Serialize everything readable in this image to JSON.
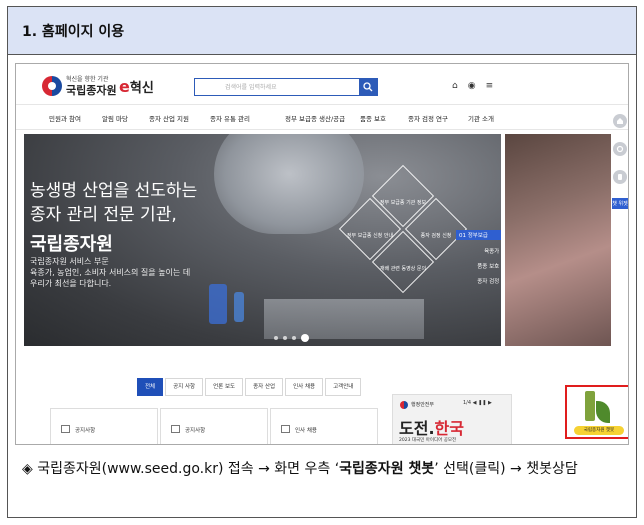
{
  "header": {
    "title": "1. 홈페이지 이용"
  },
  "site": {
    "logo_sub": "혁신을 향한 기관",
    "logo_name": "국립종자원",
    "logo_e": "e",
    "logo_hyeoksin": "혁신",
    "search_placeholder": "검색어를 입력하세요",
    "top_icons": [
      "home-icon",
      "globe-icon",
      "menu-icon"
    ]
  },
  "nav": [
    "민원과 참여",
    "알림 마당",
    "종자 산업 지원",
    "종자 유통 관리",
    "정부 보급종 생산/공급",
    "품종 보호",
    "종자 검정 연구",
    "기관 소개"
  ],
  "hero": {
    "line1": "농생명 산업을 선도하는",
    "line2": "종자 관리 전문 기관,",
    "line3": "국립종자원",
    "desc1": "국립종자원 서비스 부문",
    "desc2": "육종가, 농업인, 소비자 서비스의 질을 높이는 데",
    "desc3": "우리가 최선을 다합니다.",
    "diamonds": [
      "정부 보급종 기관 정보",
      "정부 보급종 신청 안내",
      "종자 산업 지원",
      "종자 검정 신청",
      "재배 관련 동영상 문의"
    ],
    "right_list": [
      "01 정부보급",
      "육종가 02",
      "품종 보호 03",
      "종자 검정 04"
    ]
  },
  "side_rail": {
    "tag": "챗 위젯",
    "icons": [
      "home-icon",
      "gear-icon",
      "phone-icon"
    ]
  },
  "tabs": [
    "전체",
    "공지 사항",
    "언론 보도",
    "종자 산업",
    "인사 채용",
    "고객안내"
  ],
  "cards": [
    "공지사항",
    "공지사항",
    "인사 채용"
  ],
  "banner": {
    "ministry": "행정안전부",
    "controls": "1/4  ◀  ❚❚  ▶",
    "headline_a": "도전.",
    "headline_b": "한국",
    "small": "2023 대국민 아이디어 공모전"
  },
  "chatbot": {
    "label": "국립종자원 챗봇"
  },
  "caption": {
    "bullet": "◈",
    "part1": " 국립종자원(www.seed.go.kr) 접속 → 화면 우측 ‘",
    "bold": "국립종자원 챗봇",
    "part2": "’ 선택(클릭) → 챗봇상담"
  }
}
